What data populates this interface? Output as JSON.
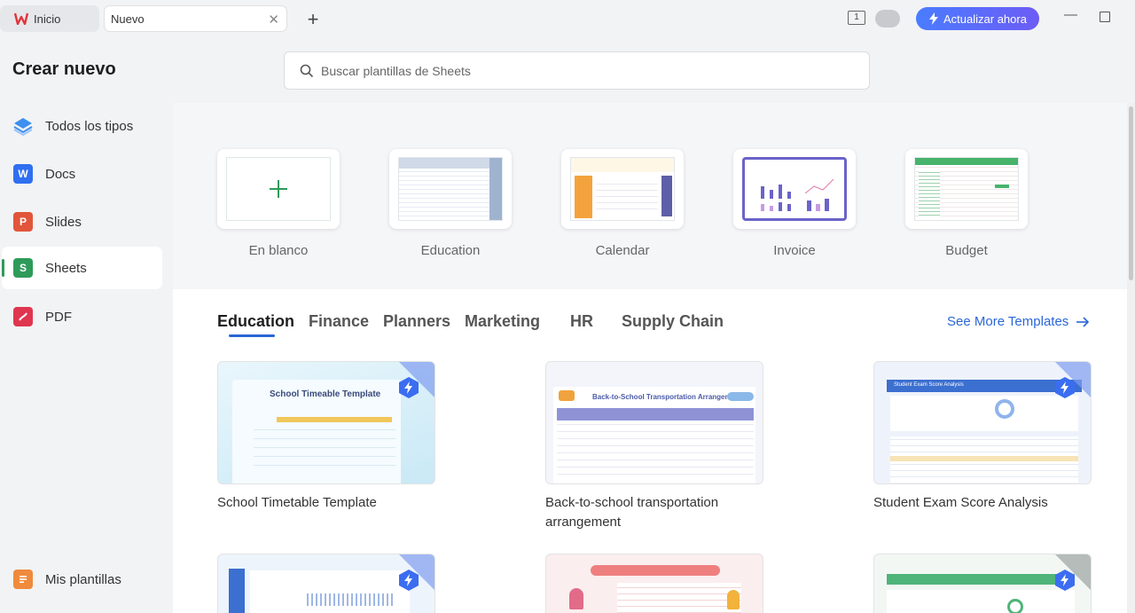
{
  "tabs": {
    "home_label": "Inicio",
    "new_label": "Nuevo"
  },
  "topbar": {
    "upgrade_label": "Actualizar ahora",
    "counter": "1"
  },
  "sidebar": {
    "title": "Crear nuevo",
    "items": [
      {
        "label": "Todos los tipos",
        "icon": "layers-icon"
      },
      {
        "label": "Docs",
        "icon": "W"
      },
      {
        "label": "Slides",
        "icon": "P"
      },
      {
        "label": "Sheets",
        "icon": "S"
      },
      {
        "label": "PDF",
        "icon": "pdf-icon"
      }
    ],
    "bottom_item": "Mis plantillas"
  },
  "search": {
    "placeholder": "Buscar plantillas de Sheets"
  },
  "categories": [
    {
      "label": "En blanco"
    },
    {
      "label": "Education"
    },
    {
      "label": "Calendar"
    },
    {
      "label": "Invoice"
    },
    {
      "label": "Budget"
    }
  ],
  "filter_tabs": [
    "Education",
    "Finance",
    "Planners",
    "Marketing",
    "HR",
    "Supply Chain"
  ],
  "see_more": "See More Templates",
  "templates": [
    {
      "title": "School Timetable Template",
      "thumb_heading": "School Timeable Template"
    },
    {
      "title": "Back-to-school transportation arrangement",
      "thumb_heading": "Back-to-School Transportation Arrangement"
    },
    {
      "title": "Student Exam Score Analysis",
      "thumb_heading": "Student Exam Score Analysis"
    }
  ],
  "colors": {
    "accent_blue": "#2a66d6",
    "sheets_green": "#2e9b5a",
    "upgrade_gradient_start": "#4a7cff",
    "upgrade_gradient_end": "#6d5cf5"
  }
}
